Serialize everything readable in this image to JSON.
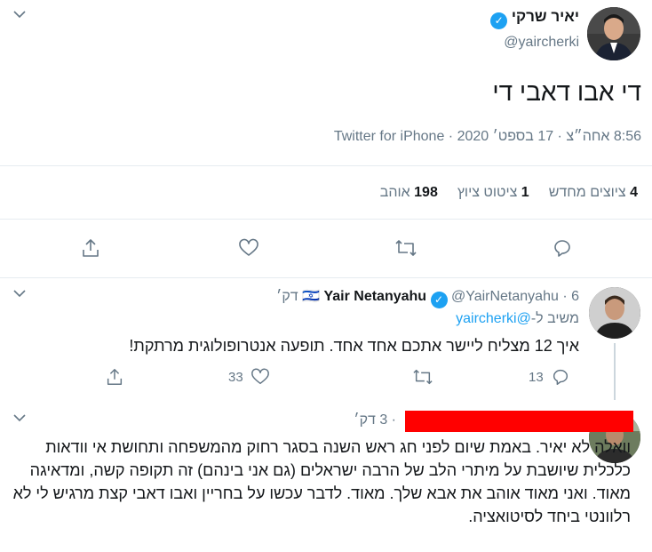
{
  "main_tweet": {
    "author_name": "יאיר שרקי",
    "author_handle": "@yaircherki",
    "text": "די אבו דאבי די",
    "meta": "8:56 אחה״צ · 17 בספט׳ 2020 · Twitter for iPhone",
    "stats": {
      "retweets_count": "4",
      "retweets_label": "ציוצים מחדש",
      "quotes_count": "1",
      "quotes_label": "ציטוט ציוץ",
      "likes_count": "198",
      "likes_label": "אוהב"
    },
    "icons": [
      "reply-icon",
      "retweet-icon",
      "like-icon",
      "share-icon"
    ]
  },
  "reply1": {
    "flag": "🇮🇱",
    "author_name": "Yair Netanyahu",
    "author_handle": "@YairNetanyahu",
    "time": "· 6 דק׳",
    "replying_prefix": "משיב ל-",
    "replying_handle": "@yaircherki",
    "text": "איך 12 מצליח ליישר אתכם אחד אחד. תופעה אנטרופולוגית מרתקת!",
    "reply_count": "13",
    "retweet_count": "",
    "like_count": "33"
  },
  "reply2": {
    "time": "· 3 דק׳",
    "text": "וואלה לא יאיר. באמת שיום לפני חג ראש השנה בסגר רחוק מהמשפחה ותחושת אי וודאות כלכלית שיושבת על מיתרי הלב של הרבה ישראלים (גם אני בינהם) זה תקופה קשה, ומדאיגה מאוד. ואני מאוד אוהב את אבא שלך. מאוד. לדבר עכשו על בחריין ואבו דאבי קצת מרגיש לי לא רלוונטי ביחד לסיטואציה.",
    "redaction_color": "#ff0000"
  },
  "colors": {
    "accent": "#1da1f2",
    "muted": "#657786",
    "text": "#14171a",
    "border": "#e6ecf0"
  }
}
